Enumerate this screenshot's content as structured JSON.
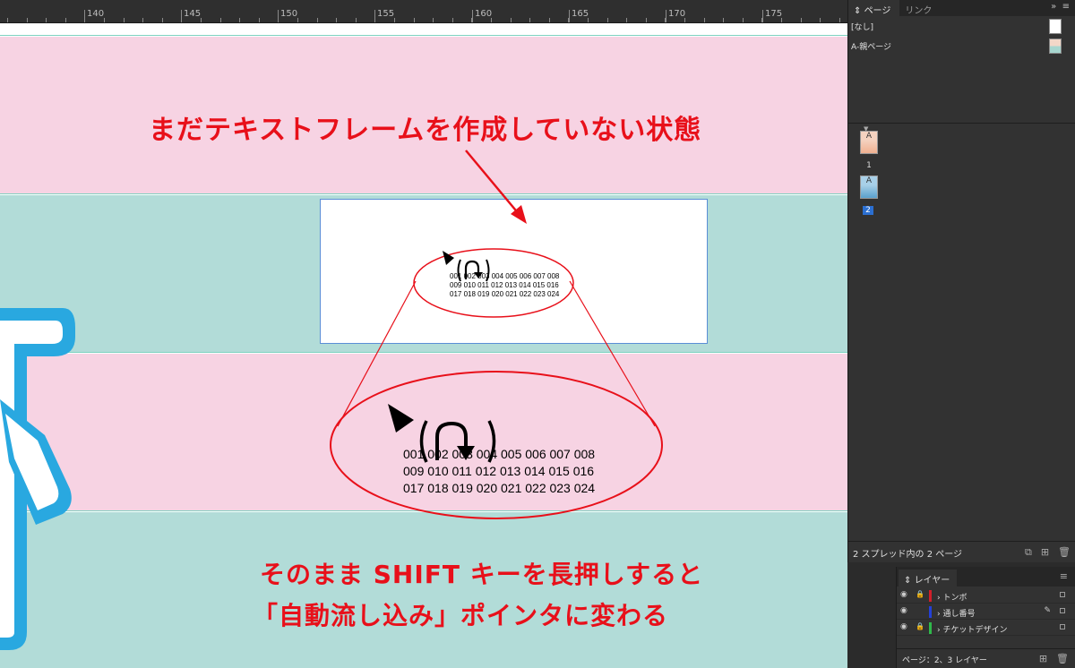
{
  "ruler": {
    "labels": [
      "140",
      "145",
      "150",
      "155",
      "160",
      "165",
      "170",
      "175"
    ]
  },
  "canvas": {
    "caption_top": "まだテキストフレームを作成していない状態",
    "caption_bottom_line1": "そのまま SHIFT キーを長押しすると",
    "caption_bottom_line2": "「自動流し込み」ポインタに変わる",
    "number_text": "001 002 003 004 005 006 007 008\n009 010 011 012 013 014 015 016\n017 018 019 020 021 022 023 024",
    "colors": {
      "pink_band": "#f7d3e3",
      "teal_band": "#b2dcd8",
      "annotation_red": "#e8101a",
      "shape_blue": "#29a8e0"
    }
  },
  "pages_panel": {
    "tabs": [
      "ページ",
      "リンク"
    ],
    "masters": [
      "[なし]",
      "A-親ページ"
    ],
    "pages": [
      {
        "number": "1",
        "master_letter": "A"
      },
      {
        "number": "2",
        "master_letter": "A"
      }
    ],
    "footer_text": "2 スプレッド内の 2 ページ"
  },
  "layers_panel": {
    "tab": "レイヤー",
    "layers": [
      {
        "name": "トンボ",
        "color": "#d21f2a",
        "locked": true
      },
      {
        "name": "通し番号",
        "color": "#2440d8",
        "locked": false
      },
      {
        "name": "チケットデザイン",
        "color": "#2fb84a",
        "locked": true
      }
    ],
    "footer_text": "ページ：2、3 レイヤー"
  }
}
